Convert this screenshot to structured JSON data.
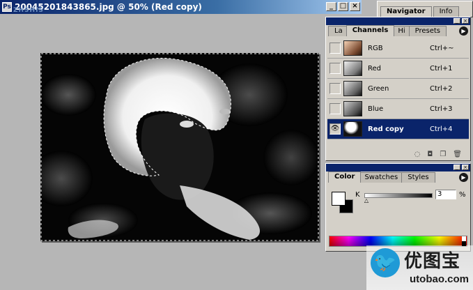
{
  "document": {
    "title": "20045201843865.jpg @ 50% (Red copy)",
    "watermark": "ZHSHIS",
    "buttons": {
      "minimize": "_",
      "maximize": "□",
      "close": "×"
    }
  },
  "navigator_panel": {
    "tabs": [
      {
        "label": "Navigator",
        "active": true
      },
      {
        "label": "Info",
        "active": false
      }
    ]
  },
  "channels_panel": {
    "tabs": [
      {
        "label": "La",
        "active": false
      },
      {
        "label": "Channels",
        "active": true
      },
      {
        "label": "Hi",
        "active": false
      },
      {
        "label": "Presets",
        "active": false
      }
    ],
    "menu_icon": "palette-menu-arrow",
    "channels": [
      {
        "name": "RGB",
        "shortcut": "Ctrl+~",
        "visible": false,
        "selected": false
      },
      {
        "name": "Red",
        "shortcut": "Ctrl+1",
        "visible": false,
        "selected": false
      },
      {
        "name": "Green",
        "shortcut": "Ctrl+2",
        "visible": false,
        "selected": false
      },
      {
        "name": "Blue",
        "shortcut": "Ctrl+3",
        "visible": false,
        "selected": false
      },
      {
        "name": "Red copy",
        "shortcut": "Ctrl+4",
        "visible": true,
        "selected": true
      }
    ],
    "footer_icons": [
      "load-selection-icon",
      "save-selection-icon",
      "new-channel-icon",
      "trash-icon"
    ]
  },
  "color_panel": {
    "tabs": [
      {
        "label": "Color",
        "active": true
      },
      {
        "label": "Swatches",
        "active": false
      },
      {
        "label": "Styles",
        "active": false
      }
    ],
    "channel_label": "K",
    "value": "3",
    "value_fraction": 0.03,
    "unit": "%",
    "foreground": "#ffffff",
    "background": "#000000"
  },
  "watermark": {
    "chinese": "优图宝",
    "url": "utobao.com"
  },
  "colors": {
    "title_gradient_start": "#0a246a",
    "selection_highlight": "#0a246a",
    "panel_face": "#d4d0c8"
  }
}
